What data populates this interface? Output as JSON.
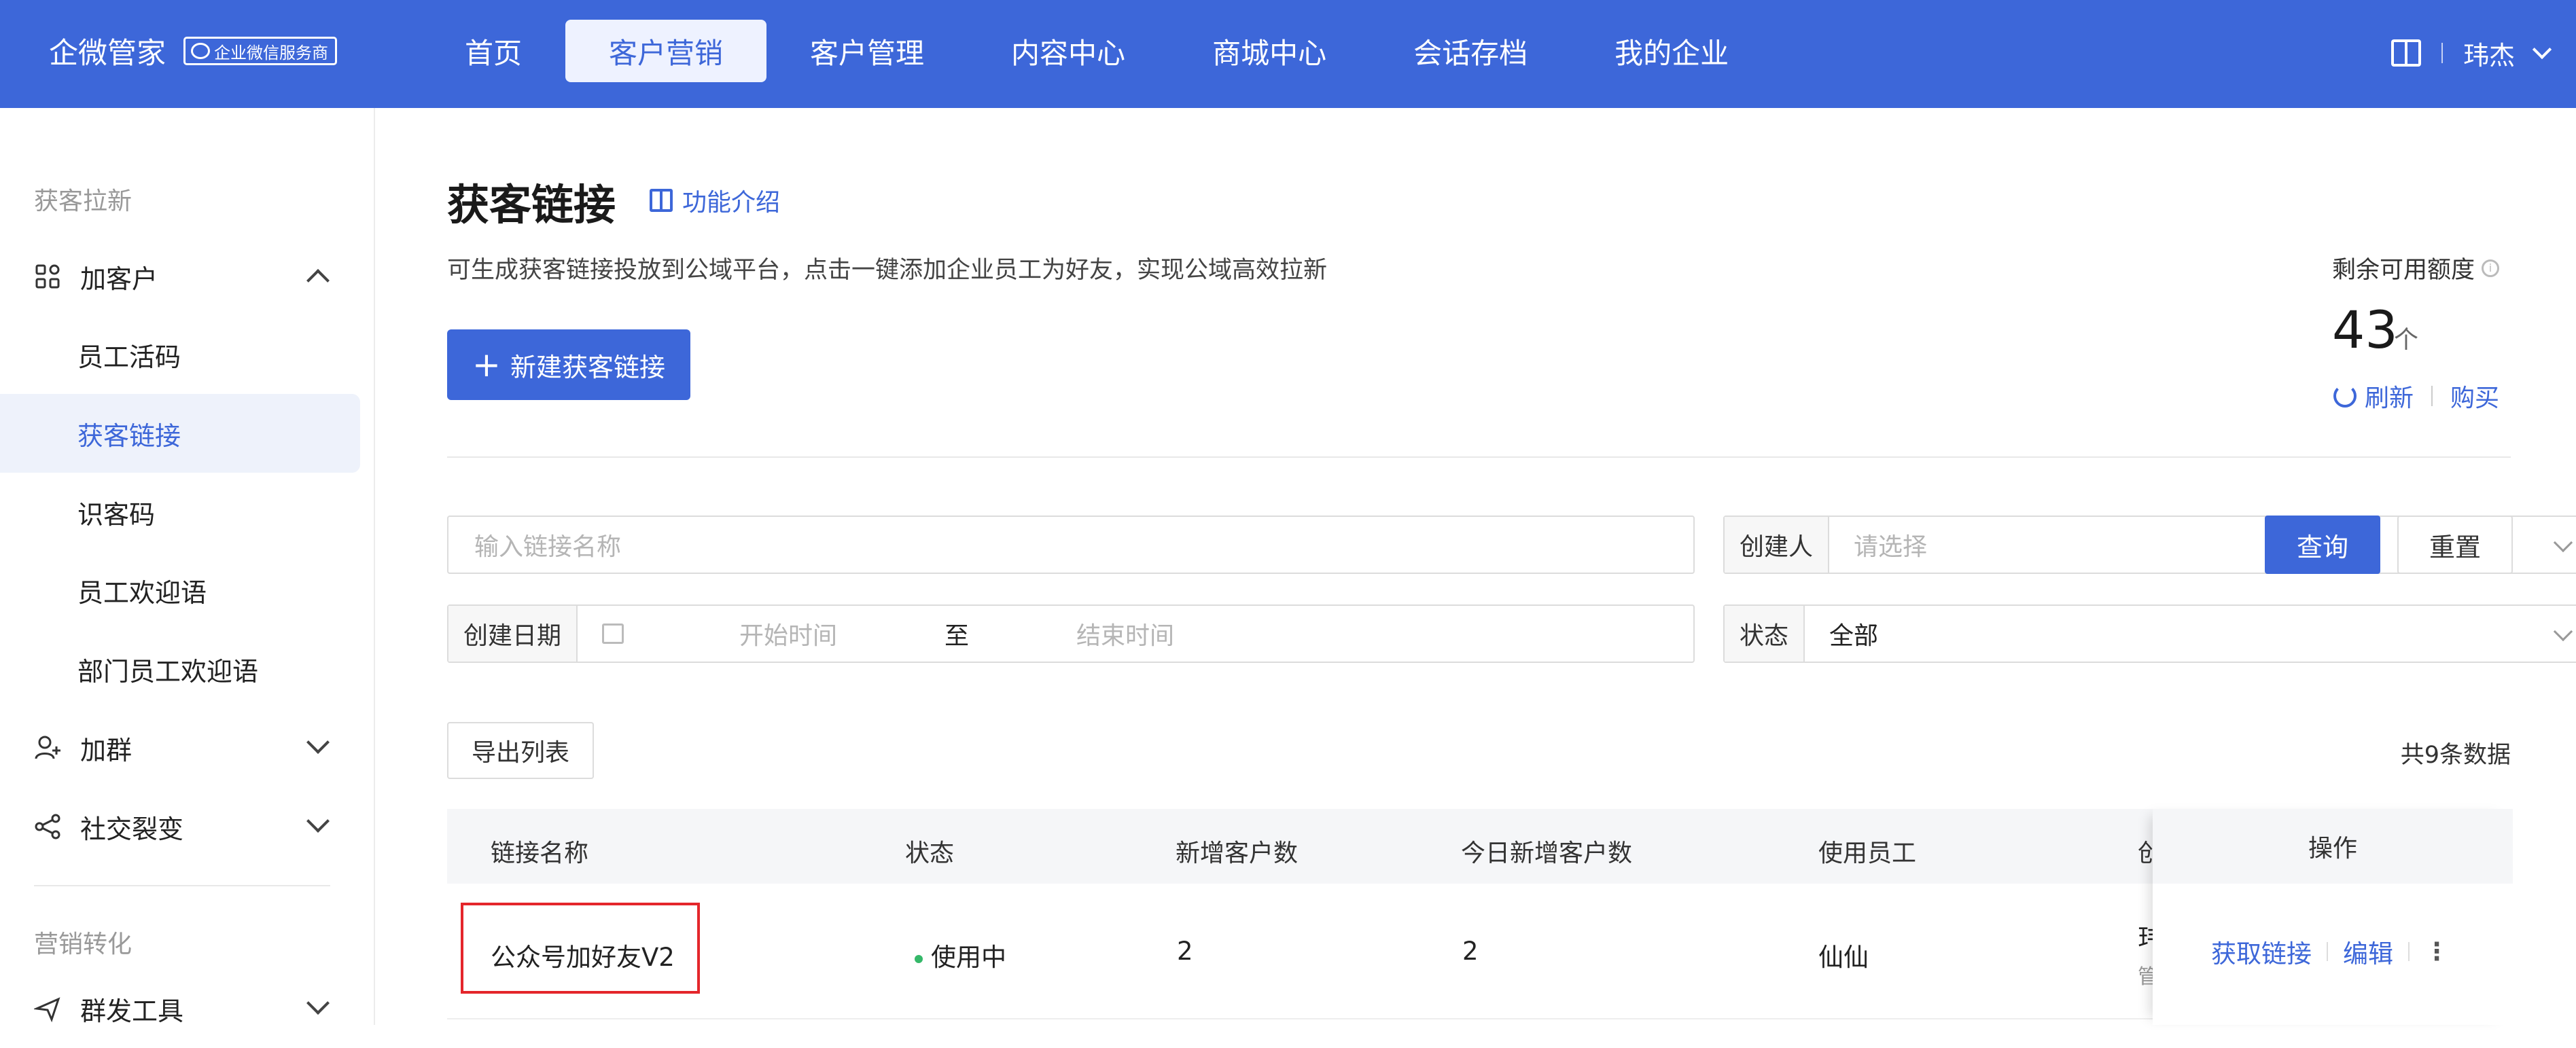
{
  "header": {
    "logo": "企微管家",
    "badge": "企业微信服务商",
    "nav": [
      "首页",
      "客户营销",
      "客户管理",
      "内容中心",
      "商城中心",
      "会话存档",
      "我的企业"
    ],
    "active_nav": "客户营销",
    "user": "玮杰"
  },
  "sidebar": {
    "group1": "获客拉新",
    "add_customer": "加客户",
    "sub_items": [
      "员工活码",
      "获客链接",
      "识客码",
      "员工欢迎语",
      "部门员工欢迎语"
    ],
    "add_group": "加群",
    "social": "社交裂变",
    "group2": "营销转化",
    "mass_tool": "群发工具"
  },
  "main": {
    "title": "获客链接",
    "intro_link": "功能介绍",
    "description": "可生成获客链接投放到公域平台，点击一键添加企业员工为好友，实现公域高效拉新",
    "new_button": "新建获客链接",
    "quota_label": "剩余可用额度",
    "quota_value": "43",
    "quota_unit": "个",
    "refresh": "刷新",
    "buy": "购买"
  },
  "filters": {
    "name_placeholder": "输入链接名称",
    "creator_label": "创建人",
    "creator_placeholder": "请选择",
    "date_label": "创建日期",
    "start_placeholder": "开始时间",
    "to": "至",
    "end_placeholder": "结束时间",
    "status_label": "状态",
    "status_value": "全部",
    "query": "查询",
    "reset": "重置"
  },
  "list": {
    "export": "导出列表",
    "total": "共9条数据",
    "columns": [
      "链接名称",
      "状态",
      "新增客户数",
      "今日新增客户数",
      "使用员工",
      "创",
      "操作"
    ],
    "rows": [
      {
        "name": "公众号加好友V2",
        "status": "使用中",
        "new_customers": "2",
        "today_new": "2",
        "staff": "仙仙",
        "creator_cut": "玮",
        "creator_sub_cut": "管",
        "actions": [
          "获取链接",
          "编辑"
        ]
      }
    ]
  },
  "colors": {
    "primary": "#3d67d9",
    "status_active": "#35b869",
    "highlight": "#e4262b"
  }
}
